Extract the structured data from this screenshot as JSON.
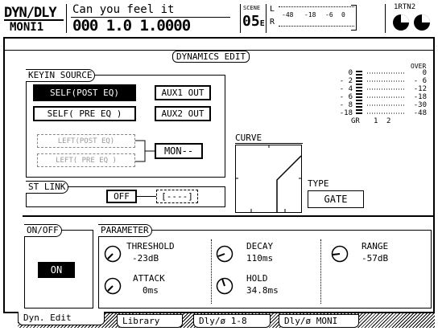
{
  "header": {
    "screen_title": "DYN/DLY",
    "screen_sub": "MONI1",
    "song_title": "Can you feel it",
    "counter": "000 1.0 1.0000",
    "scene_label": "SCENE",
    "scene_number": "05",
    "scene_suffix": "E",
    "meter_l": "L",
    "meter_r": "R",
    "meter_ticks": [
      "-48",
      "-18",
      "-6",
      "0"
    ],
    "rtn_label": "RTN",
    "rtn_number": "2"
  },
  "panel_title": "DYNAMICS EDIT",
  "keyin": {
    "title": "KEYIN SOURCE",
    "self_post": "SELF(POST EQ)",
    "self_pre": "SELF( PRE EQ )",
    "aux1": "AUX1 OUT",
    "aux2": "AUX2 OUT",
    "left_post": "LEFT(POST EQ)",
    "left_pre": "LEFT( PRE EQ )",
    "mon": "MON--"
  },
  "stlink": {
    "title": "ST LINK",
    "state": "OFF",
    "target": "----"
  },
  "curve_label": "CURVE",
  "type": {
    "label": "TYPE",
    "value": "GATE"
  },
  "meter": {
    "over_label": "OVER",
    "scale": [
      "0",
      "- 2",
      "- 4",
      "- 6",
      "- 8",
      "-18"
    ],
    "gr_scale": [
      "0",
      "- 6",
      "-12",
      "-18",
      "-30",
      "-48"
    ],
    "gr_label": "GR",
    "ch1": "1",
    "ch2": "2"
  },
  "onoff": {
    "title": "ON/OFF",
    "state": "ON"
  },
  "parameter": {
    "title": "PARAMETER",
    "threshold_label": "THRESHOLD",
    "threshold_value": "-23dB",
    "attack_label": "ATTACK",
    "attack_value": "0ms",
    "decay_label": "DECAY",
    "decay_value": "110ms",
    "hold_label": "HOLD",
    "hold_value": "34.8ms",
    "range_label": "RANGE",
    "range_value": "-57dB"
  },
  "tabs": [
    "Dyn. Edit",
    "Library",
    "Dly/ø 1-8",
    "Dly/ø MONI"
  ]
}
